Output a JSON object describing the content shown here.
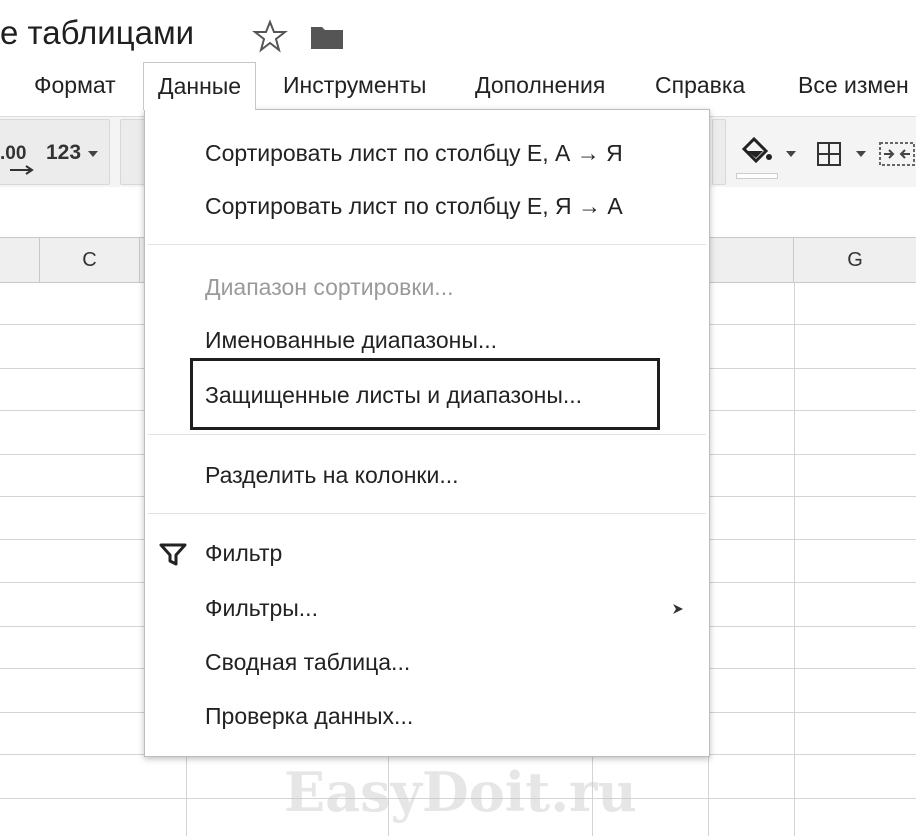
{
  "title_bar": {
    "doc_title": "е таблицами"
  },
  "menu": {
    "items": [
      {
        "label": "Формат"
      },
      {
        "label": "Данные"
      },
      {
        "label": "Инструменты"
      },
      {
        "label": "Дополнения"
      },
      {
        "label": "Справка"
      },
      {
        "label": "Все измен"
      }
    ]
  },
  "toolbar": {
    "decimal_label": ".00",
    "number_format_label": "123"
  },
  "grid": {
    "columns": [
      "C",
      "G"
    ]
  },
  "dropdown": {
    "items": [
      {
        "label": "Сортировать лист по столбцу E, А → Я",
        "disabled": false
      },
      {
        "label": "Сортировать лист по столбцу E, Я → А",
        "disabled": false
      },
      {
        "label": "Диапазон сортировки...",
        "disabled": true
      },
      {
        "label": "Именованные диапазоны...",
        "disabled": false
      },
      {
        "label": "Защищенные листы и диапазоны...",
        "disabled": false,
        "highlighted": true
      },
      {
        "label": "Разделить на колонки...",
        "disabled": false
      },
      {
        "label": "Фильтр",
        "disabled": false,
        "icon": "filter-icon"
      },
      {
        "label": "Фильтры...",
        "disabled": false,
        "has_submenu": true
      },
      {
        "label": "Сводная таблица...",
        "disabled": false
      },
      {
        "label": "Проверка данных...",
        "disabled": false
      }
    ]
  },
  "watermark": "EasyDoit.ru"
}
